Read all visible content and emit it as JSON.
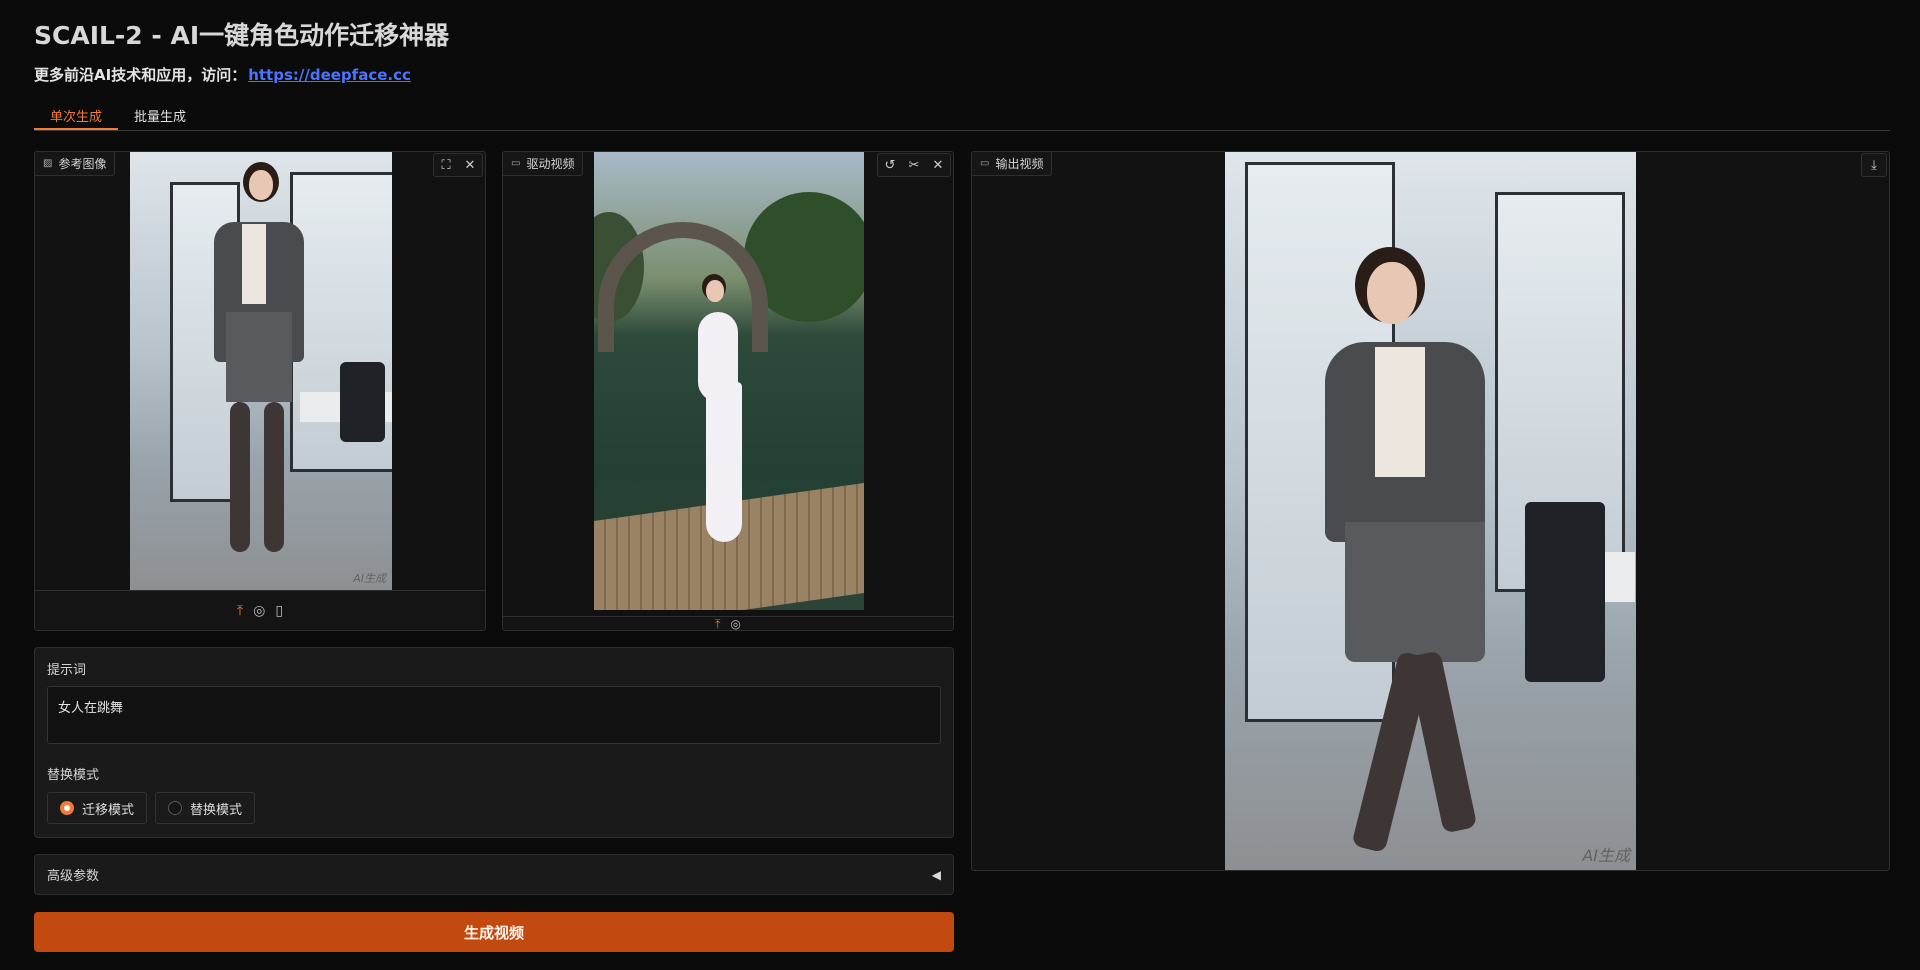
{
  "header": {
    "title": "SCAIL-2 - AI一键角色动作迁移神器",
    "subtitle_prefix": "更多前沿AI技术和应用，访问：",
    "subtitle_link": "https://deepface.cc"
  },
  "tabs": [
    {
      "label": "单次生成",
      "active": true
    },
    {
      "label": "批量生成",
      "active": false
    }
  ],
  "reference_image": {
    "label": "参考图像",
    "watermark": "AI生成"
  },
  "driving_video": {
    "label": "驱动视频"
  },
  "output_video": {
    "label": "输出视频",
    "watermark": "AI生成"
  },
  "prompt": {
    "label": "提示词",
    "value": "女人在跳舞"
  },
  "mode": {
    "label": "替换模式",
    "options": [
      "迁移模式",
      "替换模式"
    ],
    "selected": "迁移模式"
  },
  "advanced": {
    "label": "高级参数"
  },
  "generate_button": "生成视频",
  "colors": {
    "accent": "#f07a36",
    "button": "#c24a10",
    "background": "#0b0b0c"
  }
}
